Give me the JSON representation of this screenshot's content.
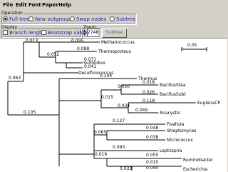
{
  "menu": {
    "file": "File",
    "edit": "Edit",
    "font": "Font",
    "paper": "Paper",
    "help": "Help"
  },
  "operation": {
    "legend": "Operation",
    "full_tree": "Full tree",
    "new_outgroup": "New outgroup",
    "swap_nodes": "Swap nodes",
    "subtree": "Subtree",
    "selected": "Full tree"
  },
  "display": {
    "legend": "Display",
    "branch_lengths": "Branch lengths",
    "bootstrap_values": "Bootstrap values"
  },
  "zoom": {
    "legend": "Zoom",
    "value": "2748"
  },
  "subtree_up_button": "Subtree Up",
  "scale_bar": {
    "label": "0.05"
  },
  "tree": {
    "taxa": [
      "Methanococcus",
      "Thermoproteus",
      "Sulfolobus",
      "Desulfurococcus",
      "Thermus",
      "BacillusStea",
      "BacillusSubt",
      "EuglenaCP",
      "Anacystis",
      "Fivellula",
      "Streptomyces",
      "Micrococcus",
      "Leptospira",
      "Ruminobacter",
      "Escherichia"
    ],
    "branch_lengths": [
      "0.013",
      "0.095",
      "0.088",
      "0.052",
      "0.071",
      "0.041",
      "0.063",
      "0.104",
      "0.050",
      "0.018",
      "0.026",
      "0.015",
      "0.118",
      "0.034",
      "0.049",
      "0.127",
      "0.048",
      "0.065",
      "0.038",
      "0.093",
      "0.105",
      "0.016",
      "0.055",
      "0.010",
      "0.040",
      "0.033"
    ]
  }
}
